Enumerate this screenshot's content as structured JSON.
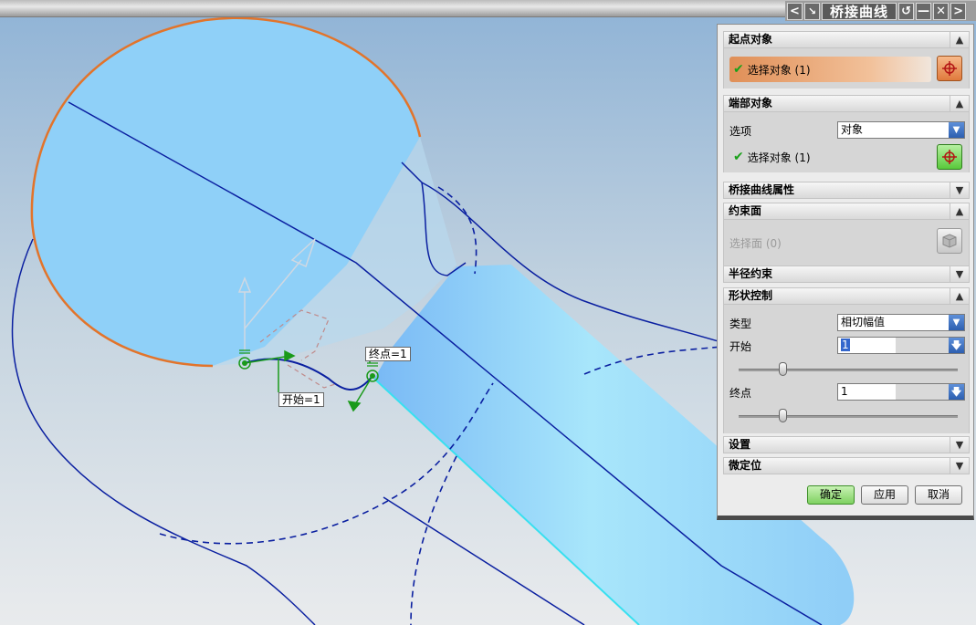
{
  "window": {
    "title": "桥接曲线",
    "nav_prev": "<",
    "nav_next": ">",
    "reset_glyph": "↺",
    "minimize_glyph": "—",
    "close_glyph": "✕"
  },
  "sections": {
    "start_object": {
      "title": "起点对象",
      "select_label": "选择对象 (1)"
    },
    "end_object": {
      "title": "端部对象",
      "option_label": "选项",
      "option_value": "对象",
      "select_label": "选择对象 (1)"
    },
    "bridge_props": {
      "title": "桥接曲线属性"
    },
    "constraint_face": {
      "title": "约束面",
      "select_label": "选择面 (0)"
    },
    "radius_constraint": {
      "title": "半径约束"
    },
    "shape_control": {
      "title": "形状控制",
      "type_label": "类型",
      "type_value": "相切幅值",
      "start_label": "开始",
      "start_value": "1",
      "start_slider_fraction": 0.2,
      "end_label": "终点",
      "end_value": "1",
      "end_slider_fraction": 0.2
    },
    "settings": {
      "title": "设置"
    },
    "fine_position": {
      "title": "微定位"
    }
  },
  "buttons": {
    "ok": "确定",
    "apply": "应用",
    "cancel": "取消"
  },
  "viewport_labels": {
    "end_tag": "终点=1",
    "start_tag": "开始=1"
  },
  "colors": {
    "accent_orange": "#e2742b",
    "face_blue": "#8fd0f8",
    "curve_blue": "#0a1fa0",
    "bridge_green": "#1a9a1a"
  }
}
